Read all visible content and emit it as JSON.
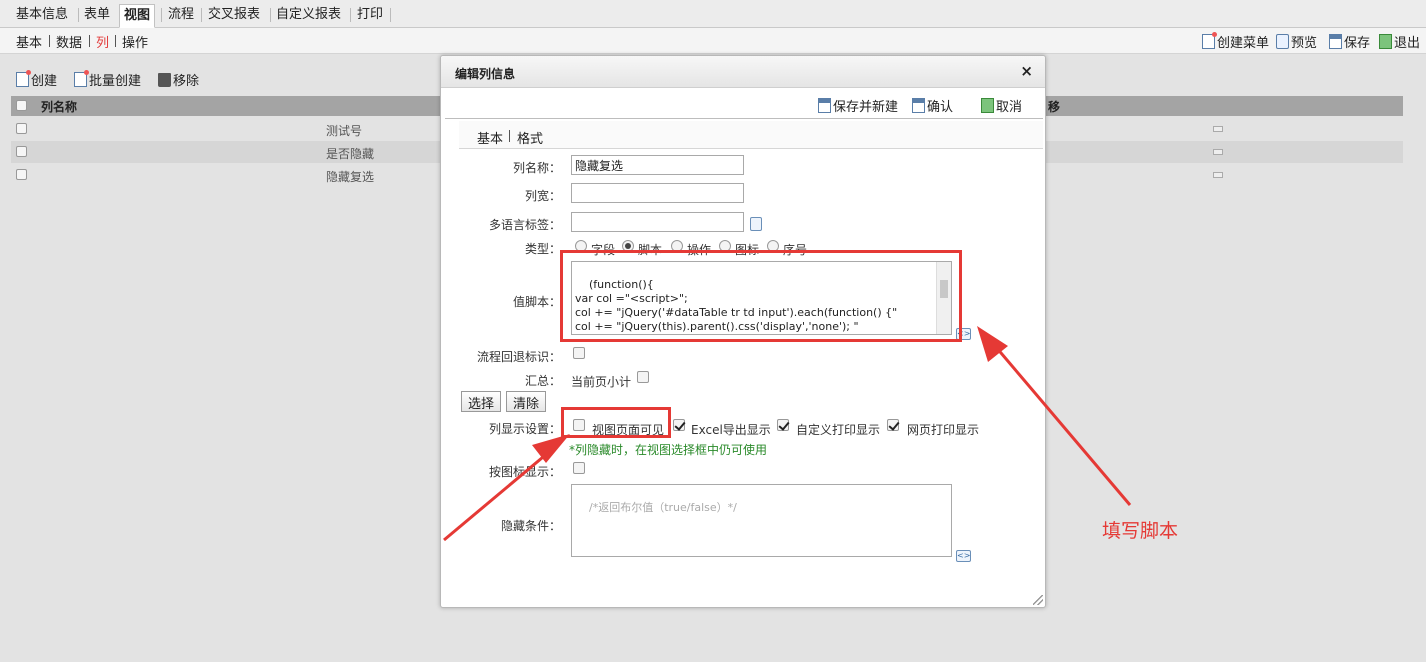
{
  "top_tabs": [
    "基本信息",
    "表单",
    "视图",
    "流程",
    "交叉报表",
    "自定义报表",
    "打印"
  ],
  "active_top_tab": "视图",
  "sub_nav": [
    "基本",
    "数据",
    "列",
    "操作"
  ],
  "active_sub_nav": "列",
  "right_toolbar": {
    "create_menu": "创建菜单",
    "preview": "预览",
    "save": "保存",
    "exit": "退出"
  },
  "left_toolbar": {
    "create": "创建",
    "batch_create": "批量创建",
    "remove": "移除"
  },
  "grid": {
    "header_name": "列名称",
    "header_right_fragment": "移",
    "rows": [
      "测试号",
      "是否隐藏",
      "隐藏复选"
    ]
  },
  "dialog": {
    "title": "编辑列信息",
    "close": "×",
    "buttons": {
      "save_new": "保存并新建",
      "confirm": "确认",
      "cancel": "取消"
    },
    "tabs": [
      "基本",
      "格式"
    ],
    "fields": {
      "name_label": "列名称：",
      "name_value": "隐藏复选",
      "width_label": "列宽：",
      "width_value": "",
      "i18n_label": "多语言标签：",
      "i18n_value": "",
      "type_label": "类型：",
      "type_options": [
        "字段",
        "脚本",
        "操作",
        "图标",
        "序号"
      ],
      "type_selected": "脚本",
      "script_label": "值脚本：",
      "script_value": "(function(){\nvar col =\"<script>\";\ncol += \"jQuery('#dataTable tr td input').each(function() {\"\ncol += \"jQuery(this).parent().css('display','none'); \"\ncol += \"});\"",
      "flow_back_label": "流程回退标识：",
      "summary_label": "汇总：",
      "page_subtotal": "当前页小计",
      "select_btn": "选择",
      "clear_btn": "清除",
      "display_label": "列显示设置：",
      "display_options": [
        "视图页面可见",
        "Excel导出显示",
        "自定义打印显示",
        "网页打印显示"
      ],
      "display_hint": "*列隐藏时，在视图选择框中仍可使用",
      "icon_display_label": "按图标显示：",
      "hide_cond_label": "隐藏条件：",
      "hide_cond_placeholder": "/*返回布尔值（true/false）*/"
    }
  },
  "annotation": {
    "text": "填写脚本",
    "color": "#e53935"
  }
}
